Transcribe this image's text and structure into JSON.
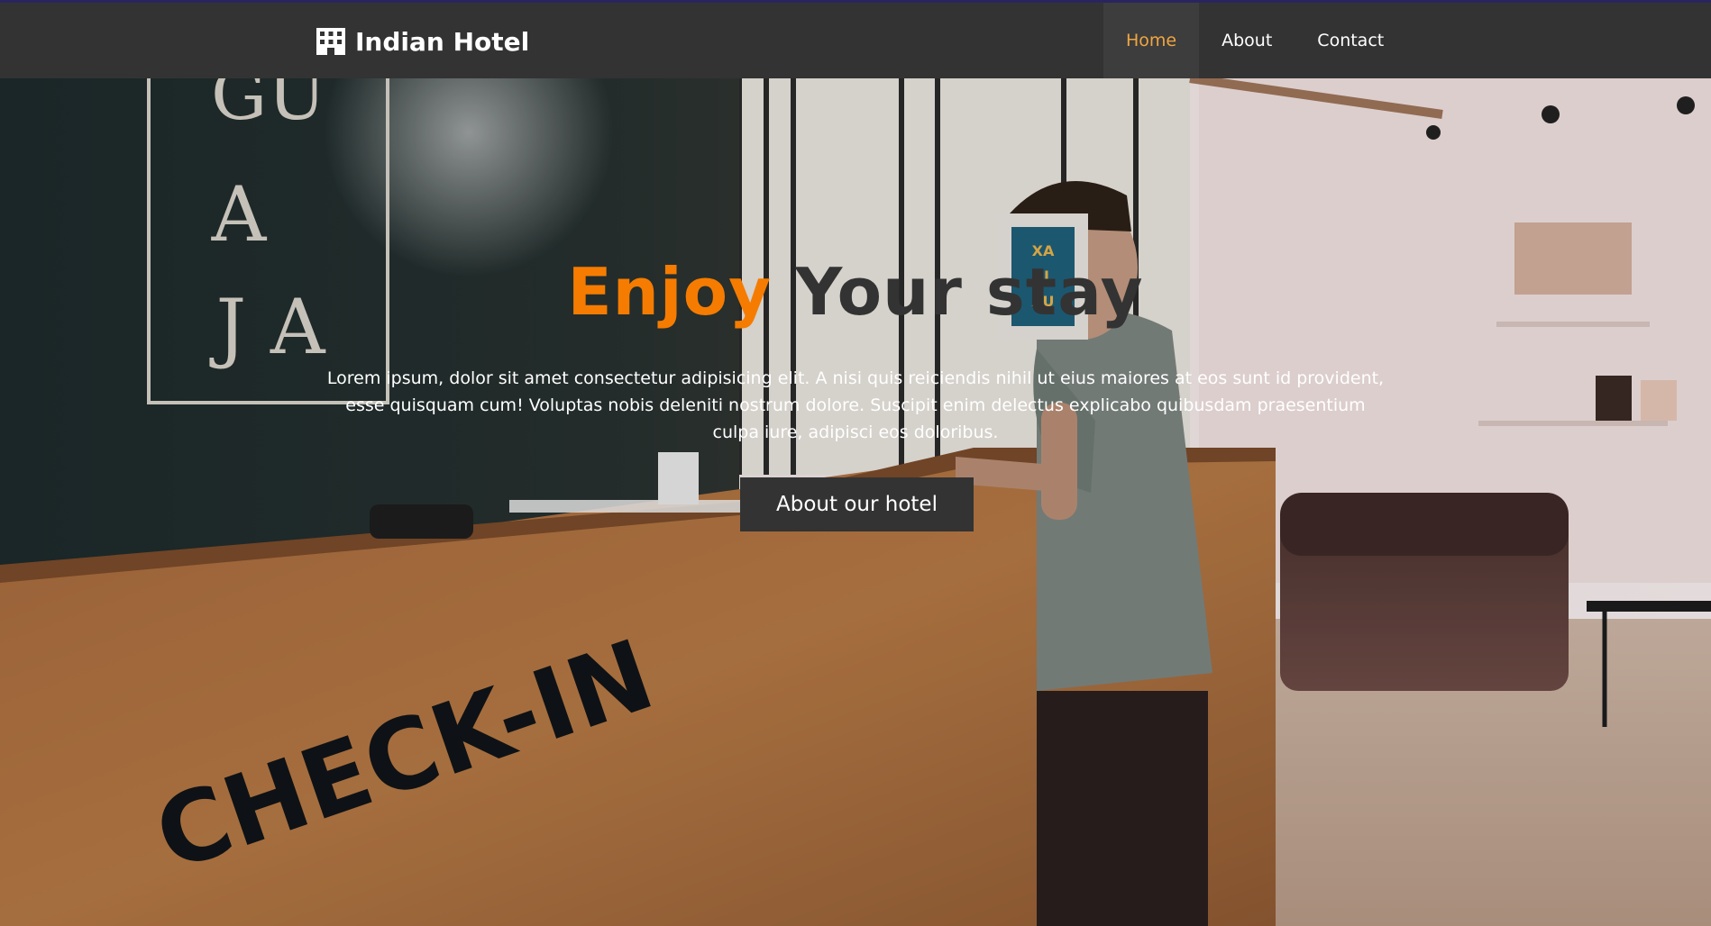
{
  "navbar": {
    "brand": "Indian Hotel",
    "brand_icon": "building-icon",
    "links": [
      {
        "label": "Home",
        "active": true
      },
      {
        "label": "About",
        "active": false
      },
      {
        "label": "Contact",
        "active": false
      }
    ]
  },
  "hero": {
    "title_accent": "Enjoy",
    "title_rest": "Your stay",
    "description": "Lorem ipsum, dolor sit amet consectetur adipisicing elit. A nisi quis reiciendis nihil ut eius maiores at eos sunt id provident, esse quisquam cum! Voluptas nobis deleniti nostrum dolore. Suscipit enim delectus explicabo quibusdam praesentium culpa iure, adipisci eos doloribus.",
    "button_label": "About our hotel",
    "background": {
      "wall_letters": [
        "GU",
        "A",
        "J A"
      ],
      "desk_text": "CHECK-IN",
      "frame_text": [
        "XA",
        "BL",
        "AU"
      ]
    }
  },
  "colors": {
    "navbar": "#333333",
    "nav_active": "#f0a640",
    "accent": "#f57c00",
    "button": "#333333"
  }
}
